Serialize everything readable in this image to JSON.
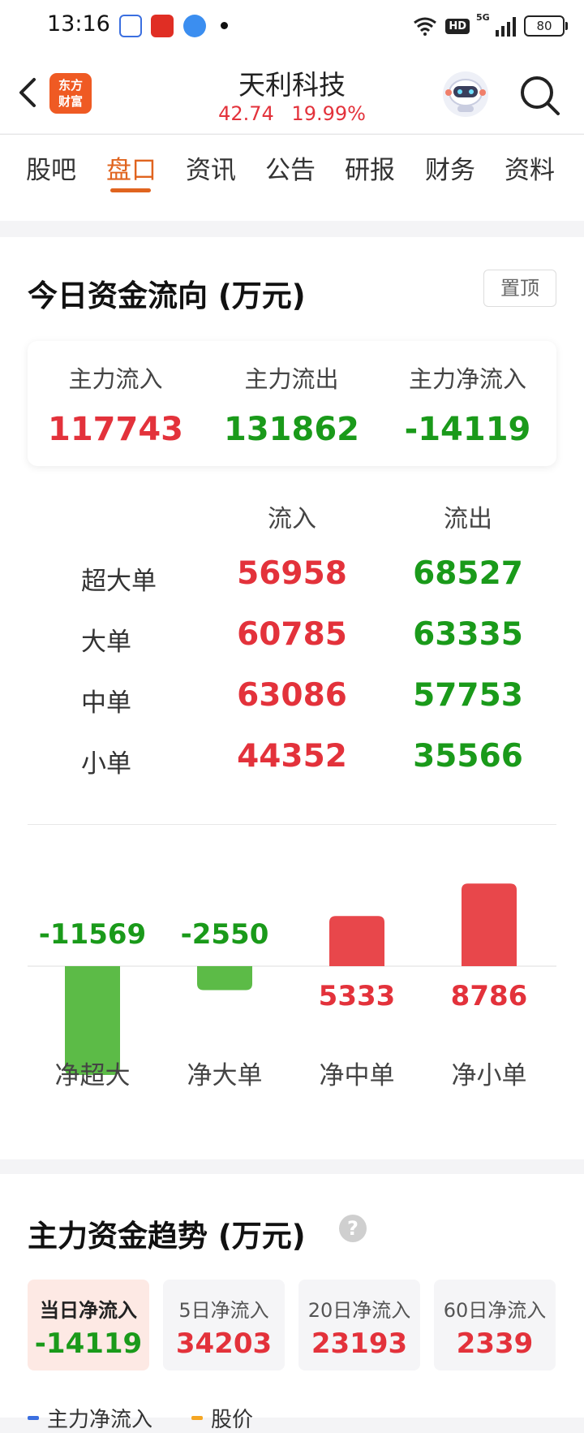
{
  "status_bar": {
    "time": "13:16",
    "network": "5G",
    "hd": "HD",
    "battery": "80"
  },
  "header": {
    "back_icon": "chevron-left-icon",
    "logo_line1": "东方",
    "logo_line2": "财富",
    "stock_name": "天利科技",
    "price": "42.74",
    "change_pct": "19.99%"
  },
  "tabs": [
    {
      "label": "股吧"
    },
    {
      "label": "盘口",
      "active": true
    },
    {
      "label": "资讯"
    },
    {
      "label": "公告"
    },
    {
      "label": "研报"
    },
    {
      "label": "财务"
    },
    {
      "label": "资料"
    }
  ],
  "capital_flow": {
    "title": "今日资金流向 (万元)",
    "pin_label": "置顶",
    "summary": [
      {
        "label": "主力流入",
        "value": "117743"
      },
      {
        "label": "主力流出",
        "value": "131862"
      },
      {
        "label": "主力净流入",
        "value": "-14119"
      }
    ],
    "col_in": "流入",
    "col_out": "流出",
    "rows": [
      {
        "label": "超大单",
        "in": "56958",
        "out": "68527"
      },
      {
        "label": "大单",
        "in": "60785",
        "out": "63335"
      },
      {
        "label": "中单",
        "in": "63086",
        "out": "57753"
      },
      {
        "label": "小单",
        "in": "44352",
        "out": "35566"
      }
    ]
  },
  "chart_data": {
    "type": "bar",
    "categories": [
      "净超大",
      "净大单",
      "净中单",
      "净小单"
    ],
    "values": [
      -11569,
      -2550,
      5333,
      8786
    ],
    "data_labels": [
      "-11569",
      "-2550",
      "5333",
      "8786"
    ],
    "colors": {
      "positive": "#e8474b",
      "negative": "#5cbb47"
    }
  },
  "trend": {
    "title": "主力资金趋势 (万元)",
    "help_icon": "question-icon",
    "boxes": [
      {
        "label": "当日净流入",
        "value": "-14119"
      },
      {
        "label": "5日净流入",
        "value": "34203"
      },
      {
        "label": "20日净流入",
        "value": "23193"
      },
      {
        "label": "60日净流入",
        "value": "2339"
      }
    ],
    "legend": [
      {
        "label": "主力净流入",
        "color": "#3b6fe0"
      },
      {
        "label": "股价",
        "color": "#f5a623"
      }
    ]
  },
  "colors": {
    "accent": "#e0641f",
    "up": "#e3323b",
    "down": "#1a9a1a"
  }
}
